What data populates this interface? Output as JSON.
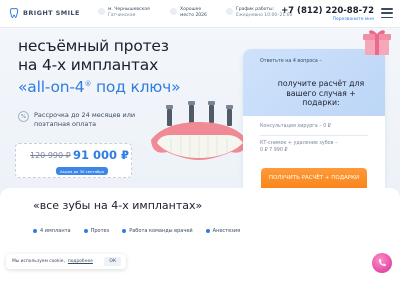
{
  "header": {
    "logo_text": "BRIGHT SMILE",
    "location": {
      "line1": "м. Чернышевская",
      "line2": "Гатчинская"
    },
    "best": {
      "line1": "Хорошее",
      "line2": "место 2026"
    },
    "hours": {
      "line1": "График работы:",
      "line2": "Ежедневно 10:00–21:00"
    },
    "phone": "+7 (812) 220-88-72",
    "callback": "Перезвоните мне",
    "icons": [
      "tooth-logo-icon",
      "metro-icon",
      "medal-icon",
      "clock-icon",
      "menu-icon"
    ]
  },
  "hero": {
    "line1": "несъёмный протез",
    "line2": "на 4-х имплантах",
    "line3_brand": "«all-on-4",
    "reg_mark": "®",
    "line3_rest": " под ключ»",
    "installment_icon": "%",
    "installment_text": "Рассрочка до 24 месяцев или поэтапная оплата"
  },
  "price": {
    "old": "120 990 ₽",
    "new": "91 000 ₽",
    "badge": "Акция до 30 сентября"
  },
  "quiz": {
    "question": "Ответьте на 4 вопроса –",
    "heading": "получите расчёт для вашего случая + подарки:",
    "items": [
      "Консультация хирурга – 0 ₽",
      "КТ-снимок + удаление зубов – 0 ₽ 7 990 ₽"
    ],
    "cta": "ПОЛУЧИТЬ РАСЧЁТ + ПОДАРКИ"
  },
  "section2": {
    "title": "«все зубы на 4-х имплантах»",
    "features": [
      "4 импланта",
      "Протез",
      "Работа команды врачей",
      "Анестезия"
    ]
  },
  "cookie": {
    "message": "Мы используем cookie,",
    "link": "подробнее",
    "ok": "ОК"
  },
  "colors": {
    "accent": "#2f7de1",
    "cta": "#f77f12",
    "chat": "#e44aa6"
  }
}
